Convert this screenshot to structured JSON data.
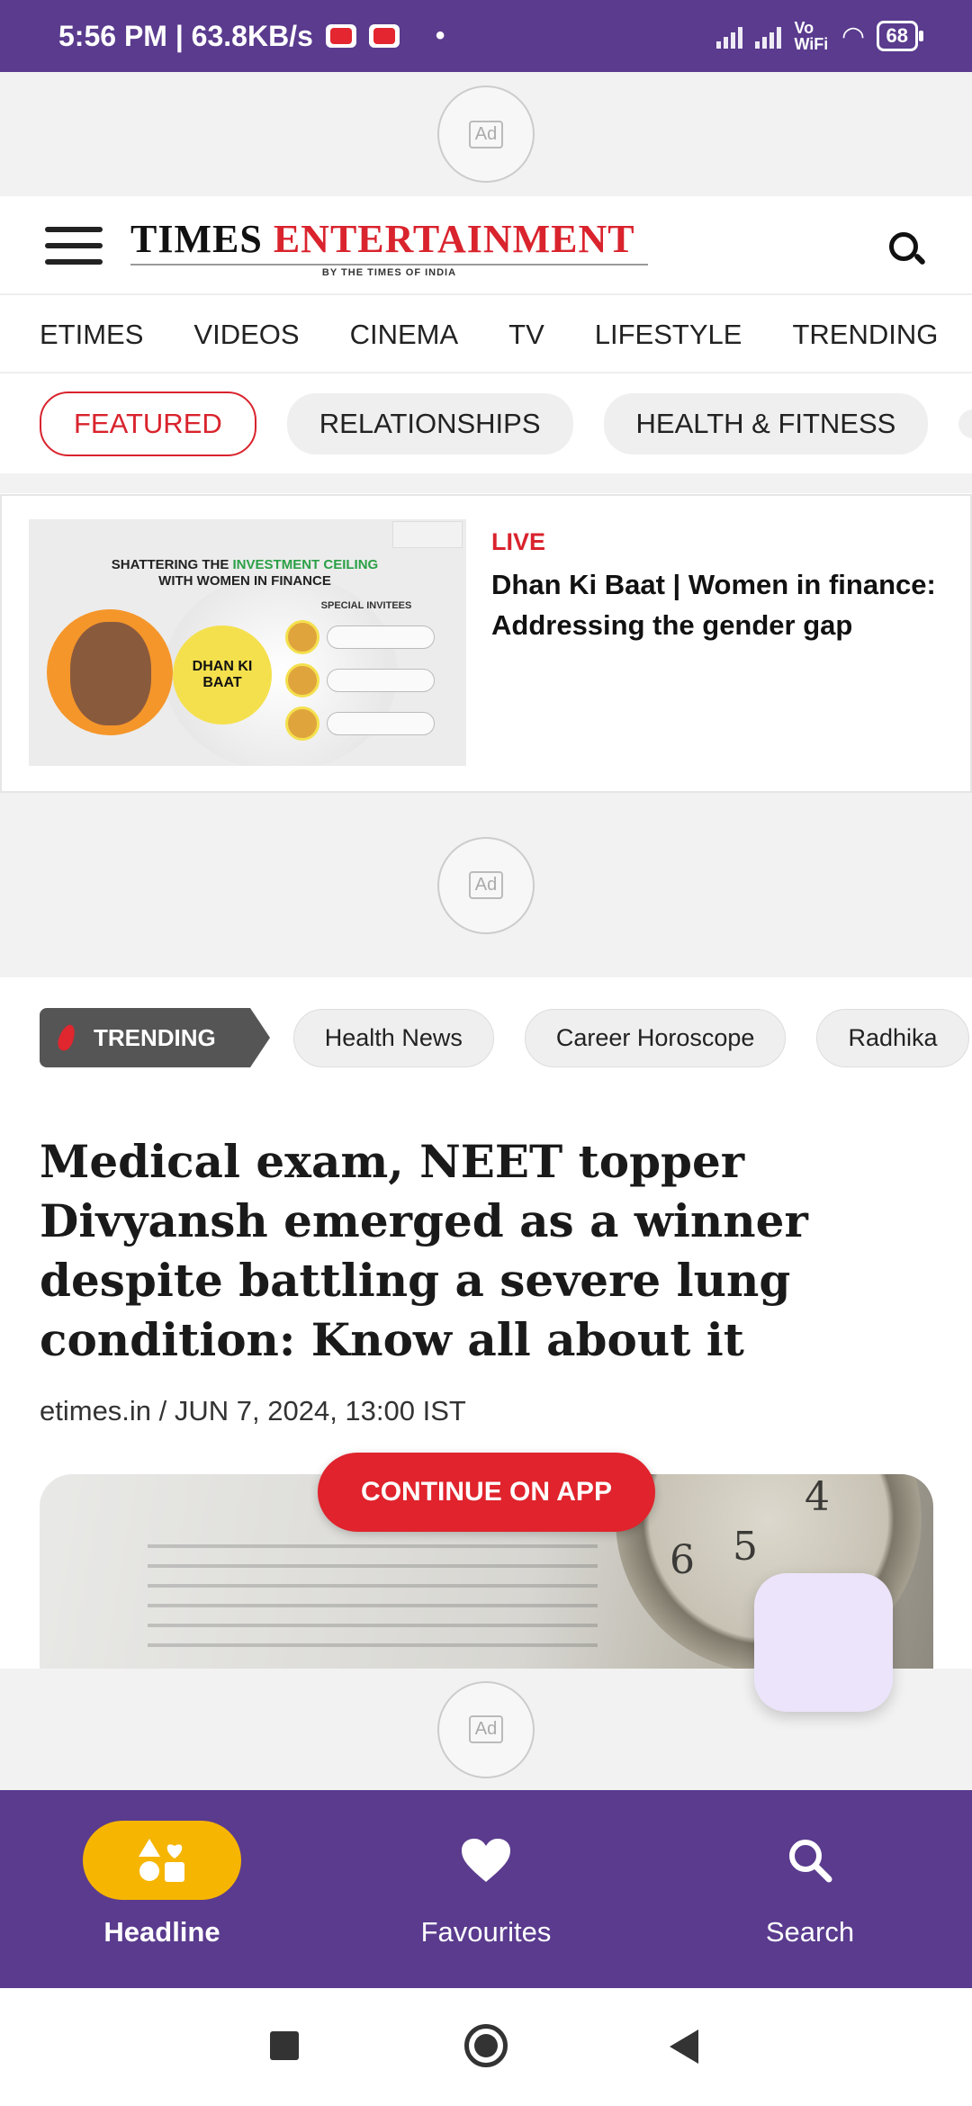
{
  "status_bar": {
    "time_speed": "5:56 PM | 63.8KB/s",
    "network_label": "Vo WiFi",
    "battery": "68"
  },
  "ads": {
    "label": "Ad"
  },
  "header": {
    "logo_part1": "TIMES",
    "logo_part2": "ENTERTAINMENT",
    "logo_tagline": "BY THE TIMES OF INDIA"
  },
  "nav_tabs": [
    "ETIMES",
    "VIDEOS",
    "CINEMA",
    "TV",
    "LIFESTYLE",
    "TRENDING"
  ],
  "category_chips": [
    "FEATURED",
    "RELATIONSHIPS",
    "HEALTH & FITNESS"
  ],
  "live_card": {
    "badge": "LIVE",
    "title": "Dhan Ki Baat | Women in finance: Addressing the gender gap",
    "thumb_heading_part1": "SHATTERING THE",
    "thumb_heading_highlight": "INVESTMENT CEILING",
    "thumb_heading_part2": "WITH WOMEN IN FINANCE",
    "thumb_special": "SPECIAL INVITEES",
    "thumb_show": "DHAN KI BAAT"
  },
  "trending": {
    "label": "TRENDING",
    "topics": [
      "Health News",
      "Career Horoscope",
      "Radhika"
    ]
  },
  "article": {
    "headline": "Medical exam, NEET topper Divyansh emerged as a winner despite battling a severe lung condition: Know all about it",
    "byline": "etimes.in / JUN 7, 2024, 13:00 IST",
    "image_clock_numbers": [
      "6",
      "5",
      "4"
    ]
  },
  "continue_button": "CONTINUE ON APP",
  "bottom_nav": {
    "items": [
      {
        "label": "Headline",
        "icon": "shapes-icon",
        "active": true
      },
      {
        "label": "Favourites",
        "icon": "heart-icon",
        "active": false
      },
      {
        "label": "Search",
        "icon": "search-icon",
        "active": false
      }
    ]
  },
  "colors": {
    "brand_purple": "#5a3b8e",
    "accent_red": "#d9232d",
    "active_pill": "#f6b500"
  }
}
